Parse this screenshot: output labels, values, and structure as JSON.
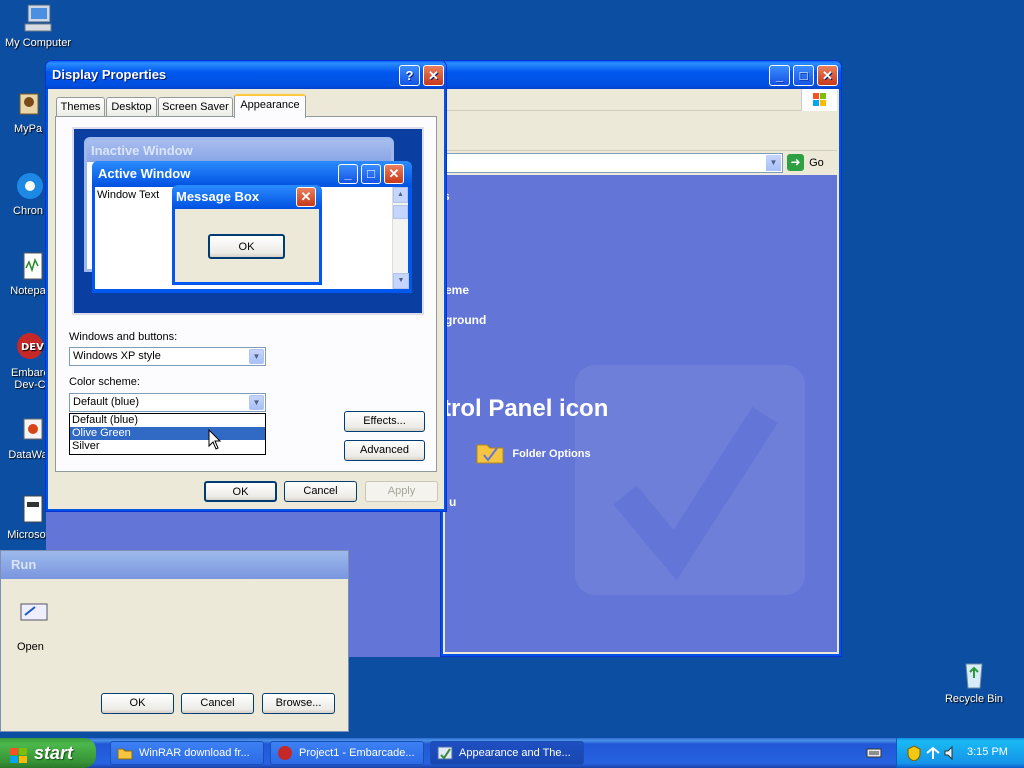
{
  "desktop": {
    "icons": [
      {
        "label": "My Computer"
      },
      {
        "label": "MyPa"
      },
      {
        "label": "Chron"
      },
      {
        "label": "Notepa"
      },
      {
        "label": "Embarc Dev-C"
      },
      {
        "label": "DataWa"
      },
      {
        "label": "Microsof"
      },
      {
        "label": "Recycle Bin"
      }
    ]
  },
  "control_panel": {
    "address_go": "Go",
    "side_texts": [
      "s",
      "eme",
      "ground"
    ],
    "heading_partial": "trol Panel icon",
    "folder_options": "Folder Options",
    "u_text": "u"
  },
  "display_properties": {
    "title": "Display Properties",
    "help_btn": "?",
    "close_btn": "✕",
    "tabs": [
      "Themes",
      "Desktop",
      "Screen Saver",
      "Appearance"
    ],
    "preview": {
      "inactive_title": "Inactive Window",
      "active_title": "Active Window",
      "window_text": "Window Text",
      "message_box_title": "Message Box",
      "ok_label": "OK"
    },
    "windows_buttons_label": "Windows and buttons:",
    "windows_buttons_value": "Windows XP style",
    "color_scheme_label": "Color scheme:",
    "color_scheme_value": "Default (blue)",
    "color_scheme_options": [
      "Default (blue)",
      "Olive Green",
      "Silver"
    ],
    "effects_btn": "Effects...",
    "advanced_btn": "Advanced",
    "ok_btn": "OK",
    "cancel_btn": "Cancel",
    "apply_btn": "Apply"
  },
  "run_dialog": {
    "title": "Run",
    "open_label": "Open",
    "ok_btn": "OK",
    "cancel_btn": "Cancel",
    "browse_btn": "Browse..."
  },
  "taskbar": {
    "start": "start",
    "tasks": [
      {
        "label": "WinRAR download fr..."
      },
      {
        "label": "Project1 - Embarcade..."
      },
      {
        "label": "Appearance and The..."
      }
    ],
    "clock": "3:15 PM"
  },
  "colors": {
    "desktop": "#0b4ea2",
    "xp_title_blue": "#0058ee",
    "selection": "#316ac5",
    "taskbar_start": "#3c9a3c"
  }
}
